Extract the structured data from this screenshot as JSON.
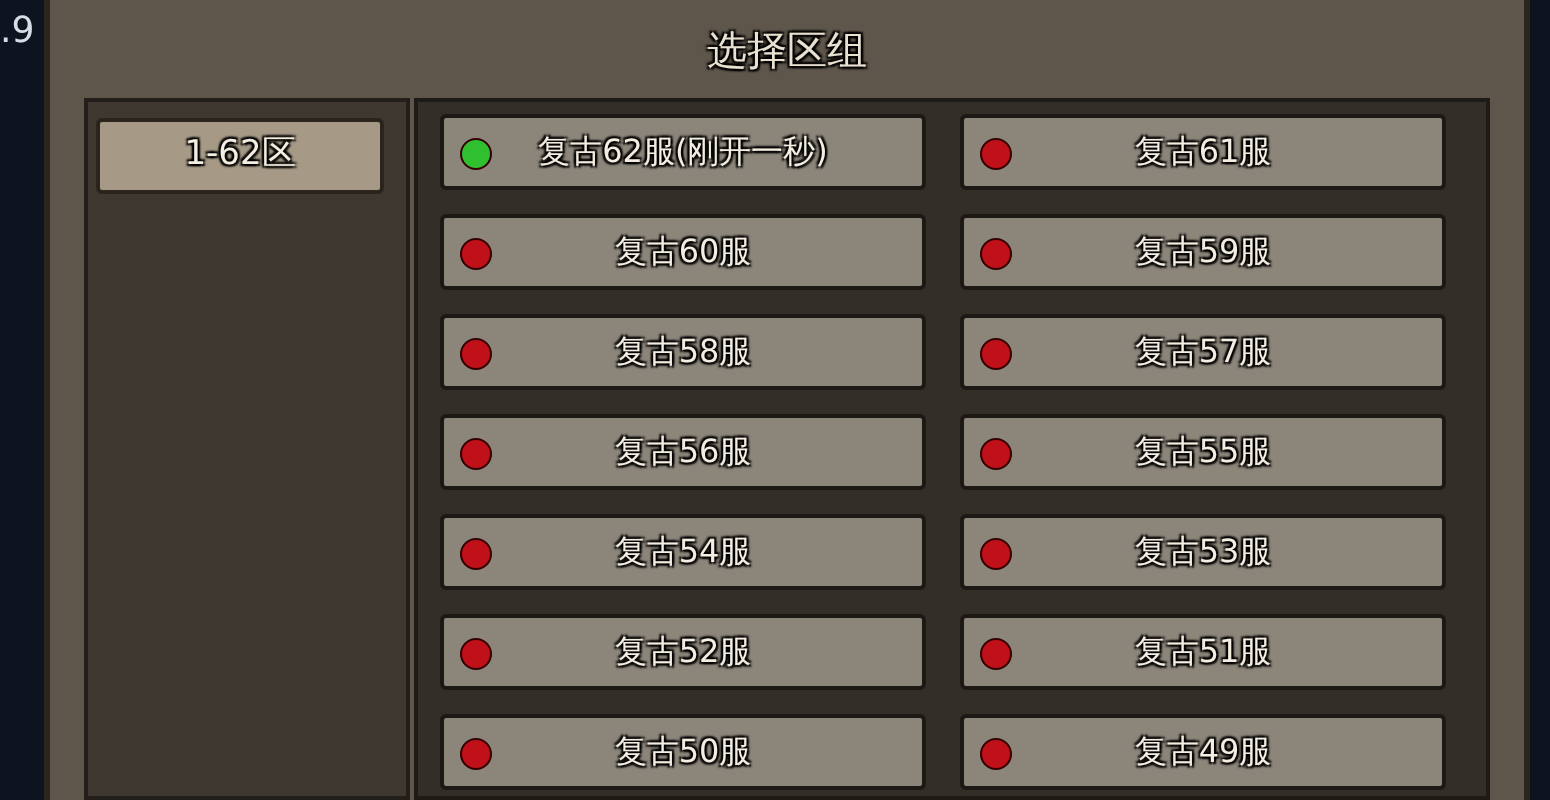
{
  "corner_text": ".9",
  "title": "选择区组",
  "zones": [
    {
      "label": "1-62区"
    }
  ],
  "servers": [
    {
      "name": "复古62服(刚开一秒)",
      "color": "#2fbf2f"
    },
    {
      "name": "复古61服",
      "color": "#c0101a"
    },
    {
      "name": "复古60服",
      "color": "#c0101a"
    },
    {
      "name": "复古59服",
      "color": "#c0101a"
    },
    {
      "name": "复古58服",
      "color": "#c0101a"
    },
    {
      "name": "复古57服",
      "color": "#c0101a"
    },
    {
      "name": "复古56服",
      "color": "#c0101a"
    },
    {
      "name": "复古55服",
      "color": "#c0101a"
    },
    {
      "name": "复古54服",
      "color": "#c0101a"
    },
    {
      "name": "复古53服",
      "color": "#c0101a"
    },
    {
      "name": "复古52服",
      "color": "#c0101a"
    },
    {
      "name": "复古51服",
      "color": "#c0101a"
    },
    {
      "name": "复古50服",
      "color": "#c0101a"
    },
    {
      "name": "复古49服",
      "color": "#c0101a"
    }
  ]
}
